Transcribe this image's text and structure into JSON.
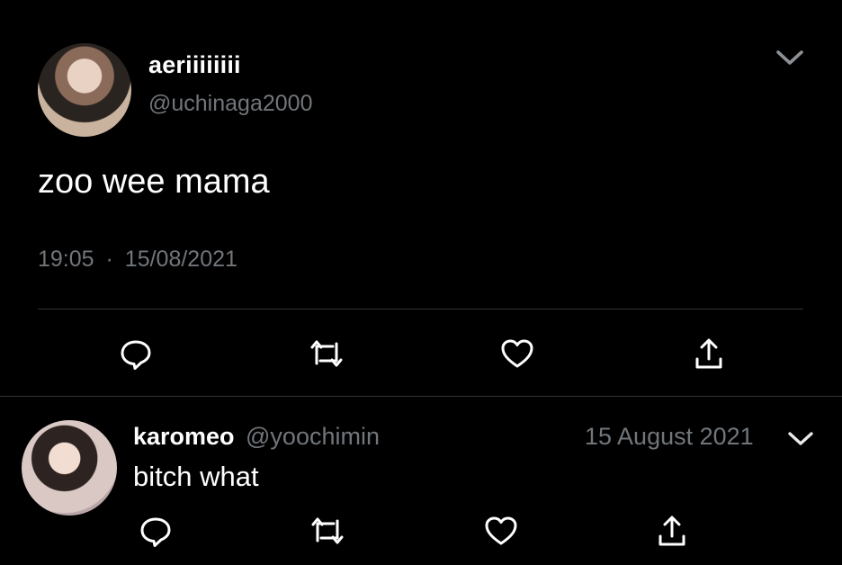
{
  "tweet": {
    "display_name": "aeriiiiiiii",
    "handle": "@uchinaga2000",
    "text": "zoo wee mama",
    "time": "19:05",
    "separator": "·",
    "date": "15/08/2021",
    "menu_icon": "chevron-down-icon",
    "actions": [
      "reply-icon",
      "retweet-icon",
      "like-icon",
      "share-icon"
    ]
  },
  "reply": {
    "display_name": "karomeo",
    "handle": "@yoochimin",
    "date": "15 August 2021",
    "text": "bitch what",
    "menu_icon": "chevron-down-icon",
    "actions": [
      "reply-icon",
      "retweet-icon",
      "like-icon",
      "share-icon"
    ]
  },
  "colors": {
    "background": "#000000",
    "text": "#ffffff",
    "secondary": "#71767b",
    "divider": "#2f3336"
  }
}
